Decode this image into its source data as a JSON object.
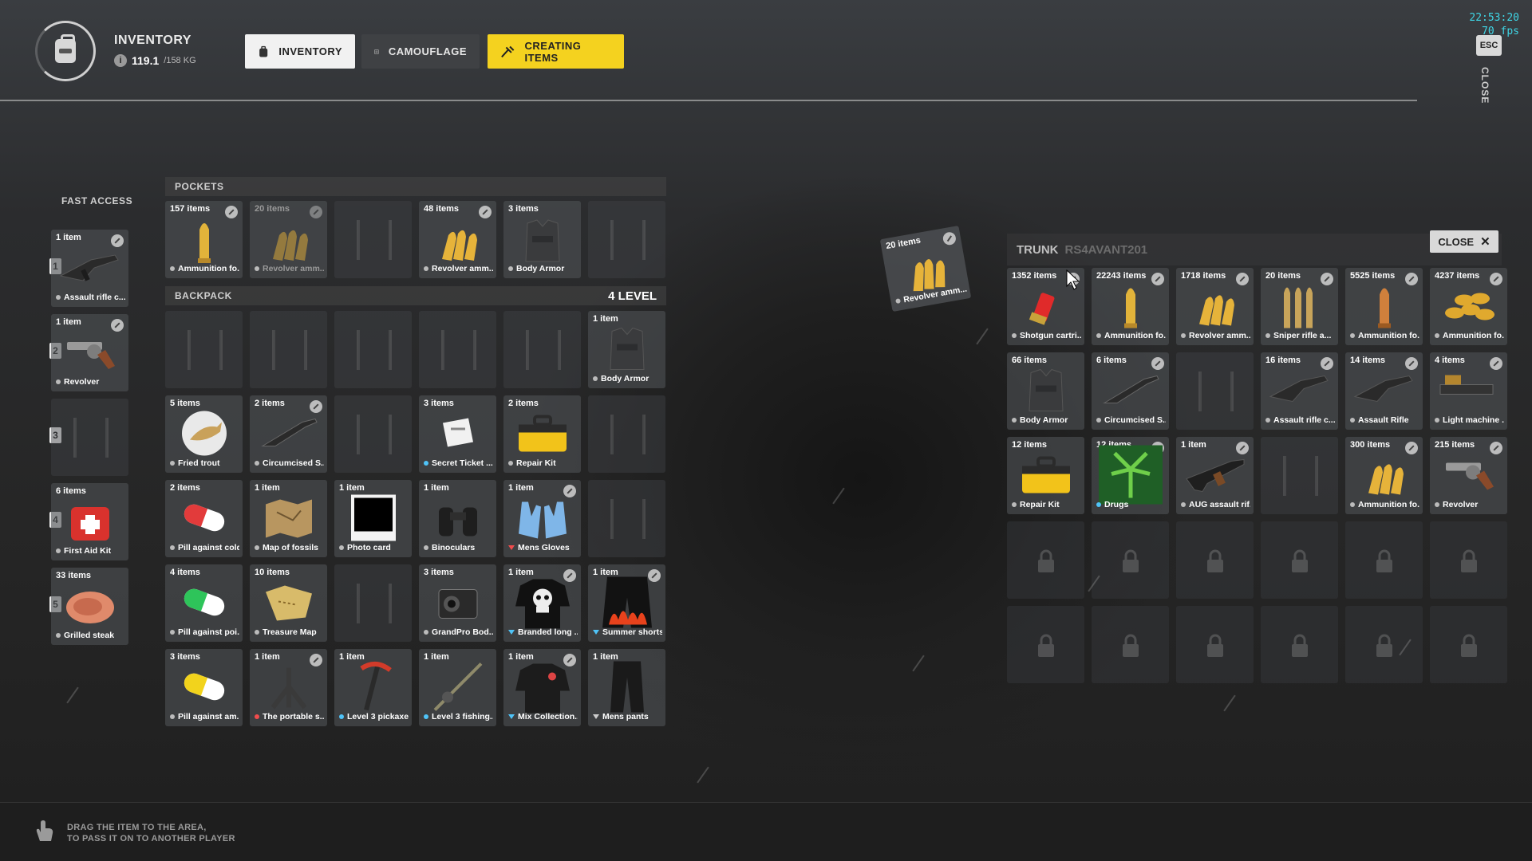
{
  "header": {
    "title": "INVENTORY",
    "weight_current": "119.1",
    "weight_max": "/158 KG",
    "tabs": [
      {
        "label": "INVENTORY",
        "icon": "backpack-icon",
        "active": true
      },
      {
        "label": "CAMOUFLAGE",
        "icon": "shirt-icon",
        "active": false
      },
      {
        "label": "CREATING ITEMS",
        "icon": "crafting-icon",
        "active": false
      }
    ],
    "clock": "22:53:20",
    "fps": "70 fps",
    "esc_label": "ESC",
    "close_label": "CLOSE"
  },
  "colors": {
    "accent": "#f4d21f",
    "hud_text": "#3fd6e6",
    "panel": "#4e5054"
  },
  "fast_access": {
    "title": "FAST ACCESS",
    "slots": [
      {
        "number": "1",
        "count": "1 item",
        "name": "Assault rifle c...",
        "icon": "assault-rifle-icon"
      },
      {
        "number": "2",
        "count": "1 item",
        "name": "Revolver",
        "icon": "revolver-icon"
      },
      {
        "number": "3",
        "count": "",
        "name": "",
        "icon": ""
      },
      {
        "number": "4",
        "count": "6 items",
        "name": "First Aid Kit",
        "icon": "first-aid-kit-icon"
      },
      {
        "number": "5",
        "count": "33 items",
        "name": "Grilled steak",
        "icon": "steak-icon"
      }
    ]
  },
  "pockets": {
    "title": "POCKETS",
    "items": [
      {
        "count": "157 items",
        "name": "Ammunition fo...",
        "icon": "bullet-icon",
        "dim": false
      },
      {
        "count": "20 items",
        "name": "Revolver amm...",
        "icon": "bullets-icon",
        "dim": true
      },
      {
        "count": "",
        "name": "",
        "icon": ""
      },
      {
        "count": "48 items",
        "name": "Revolver amm...",
        "icon": "bullets-icon",
        "dim": false
      },
      {
        "count": "3 items",
        "name": "Body Armor",
        "icon": "vest-icon",
        "dim": false
      },
      {
        "count": "",
        "name": "",
        "icon": ""
      }
    ]
  },
  "backpack": {
    "title": "BACKPACK",
    "level": "4 LEVEL",
    "items": [
      {
        "count": "",
        "name": "",
        "icon": ""
      },
      {
        "count": "",
        "name": "",
        "icon": ""
      },
      {
        "count": "",
        "name": "",
        "icon": ""
      },
      {
        "count": "",
        "name": "",
        "icon": ""
      },
      {
        "count": "",
        "name": "",
        "icon": ""
      },
      {
        "count": "1 item",
        "name": "Body Armor",
        "icon": "vest-icon"
      },
      {
        "count": "5 items",
        "name": "Fried trout",
        "icon": "fish-icon"
      },
      {
        "count": "2 items",
        "name": "Circumcised S...",
        "icon": "shotgun-icon"
      },
      {
        "count": "",
        "name": "",
        "icon": ""
      },
      {
        "count": "3 items",
        "name": "Secret Ticket ...",
        "icon": "ticket-icon",
        "marker": "blue"
      },
      {
        "count": "2 items",
        "name": "Repair Kit",
        "icon": "toolbox-icon"
      },
      {
        "count": "",
        "name": "",
        "icon": ""
      },
      {
        "count": "2 items",
        "name": "Pill against cold",
        "icon": "pill-red-icon"
      },
      {
        "count": "1 item",
        "name": "Map of fossils",
        "icon": "map-icon"
      },
      {
        "count": "1 item",
        "name": "Photo card",
        "icon": "photo-icon"
      },
      {
        "count": "1 item",
        "name": "Binoculars",
        "icon": "binoculars-icon"
      },
      {
        "count": "1 item",
        "name": "Mens Gloves",
        "icon": "gloves-icon",
        "chevron": "red"
      },
      {
        "count": "",
        "name": "",
        "icon": ""
      },
      {
        "count": "4 items",
        "name": "Pill against poi...",
        "icon": "pill-green-icon"
      },
      {
        "count": "10 items",
        "name": "Treasure Map",
        "icon": "treasure-map-icon"
      },
      {
        "count": "",
        "name": "",
        "icon": ""
      },
      {
        "count": "3 items",
        "name": "GrandPro Bod...",
        "icon": "camera-icon"
      },
      {
        "count": "1 item",
        "name": "Branded long ...",
        "icon": "skull-shirt-icon",
        "chevron": "blue"
      },
      {
        "count": "1 item",
        "name": "Summer shorts",
        "icon": "shorts-icon",
        "chevron": "blue"
      },
      {
        "count": "3 items",
        "name": "Pill against am...",
        "icon": "pill-yellow-icon"
      },
      {
        "count": "1 item",
        "name": "The portable s...",
        "icon": "stand-icon",
        "marker": "red"
      },
      {
        "count": "1 item",
        "name": "Level 3 pickaxe",
        "icon": "pickaxe-icon",
        "marker": "blue"
      },
      {
        "count": "1 item",
        "name": "Level 3 fishing...",
        "icon": "fishing-rod-icon",
        "marker": "blue"
      },
      {
        "count": "1 item",
        "name": "Mix Collection...",
        "icon": "jacket-icon",
        "chevron": "blue"
      },
      {
        "count": "1 item",
        "name": "Mens pants",
        "icon": "pants-icon",
        "chevron": "grey"
      }
    ]
  },
  "dragged_item": {
    "count": "20 items",
    "name": "Revolver amm..."
  },
  "trunk": {
    "title": "TRUNK",
    "plate": "RS4AVANT201",
    "close_label": "CLOSE",
    "items": [
      {
        "count": "1352 items",
        "name": "Shotgun cartri...",
        "icon": "shotgun-shell-icon"
      },
      {
        "count": "22243 items",
        "name": "Ammunition fo...",
        "icon": "bullet-icon"
      },
      {
        "count": "1718 items",
        "name": "Revolver amm...",
        "icon": "bullets-icon"
      },
      {
        "count": "20 items",
        "name": "Sniper rifle a...",
        "icon": "sniper-ammo-icon"
      },
      {
        "count": "5525 items",
        "name": "Ammunition fo...",
        "icon": "bullet-copper-icon"
      },
      {
        "count": "4237 items",
        "name": "Ammunition fo...",
        "icon": "bullets-pile-icon"
      },
      {
        "count": "66 items",
        "name": "Body Armor",
        "icon": "vest-icon"
      },
      {
        "count": "6 items",
        "name": "Circumcised S...",
        "icon": "shotgun-icon"
      },
      {
        "count": "",
        "name": "",
        "icon": ""
      },
      {
        "count": "16 items",
        "name": "Assault rifle c...",
        "icon": "assault-rifle-icon"
      },
      {
        "count": "14 items",
        "name": "Assault Rifle",
        "icon": "assault-rifle-icon"
      },
      {
        "count": "4 items",
        "name": "Light machine ...",
        "icon": "machine-gun-icon"
      },
      {
        "count": "12 items",
        "name": "Repair Kit",
        "icon": "toolbox-icon"
      },
      {
        "count": "12 items",
        "name": "Drugs",
        "icon": "leaf-icon",
        "marker": "blue"
      },
      {
        "count": "1 item",
        "name": "AUG assault rif...",
        "icon": "aug-rifle-icon"
      },
      {
        "count": "",
        "name": "",
        "icon": ""
      },
      {
        "count": "300 items",
        "name": "Ammunition fo...",
        "icon": "bullets-icon"
      },
      {
        "count": "215 items",
        "name": "Revolver",
        "icon": "revolver-icon"
      }
    ]
  },
  "footer": {
    "line1": "DRAG THE ITEM TO THE AREA,",
    "line2": "TO PASS IT ON TO ANOTHER PLAYER"
  }
}
